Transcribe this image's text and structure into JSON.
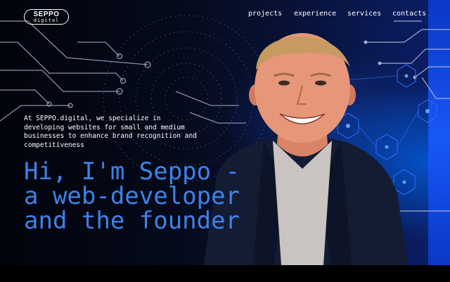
{
  "brand": {
    "line1": "SEPPO",
    "line2": "digital"
  },
  "nav": {
    "links": [
      {
        "label": "projects"
      },
      {
        "label": "experience"
      },
      {
        "label": "services"
      },
      {
        "label": "contacts"
      }
    ]
  },
  "hero": {
    "intro": "At SEPPO.digital, we specialize in developing websites for small and medium businesses to enhance brand recognition and competitiveness",
    "headline_lines": [
      "Hi, I'm Seppo -",
      "a web-developer",
      "and the founder"
    ]
  },
  "colors": {
    "accent": "#3d82ea",
    "background": "#050a1a",
    "glow": "#1a59ff",
    "text": "#ffffff"
  }
}
